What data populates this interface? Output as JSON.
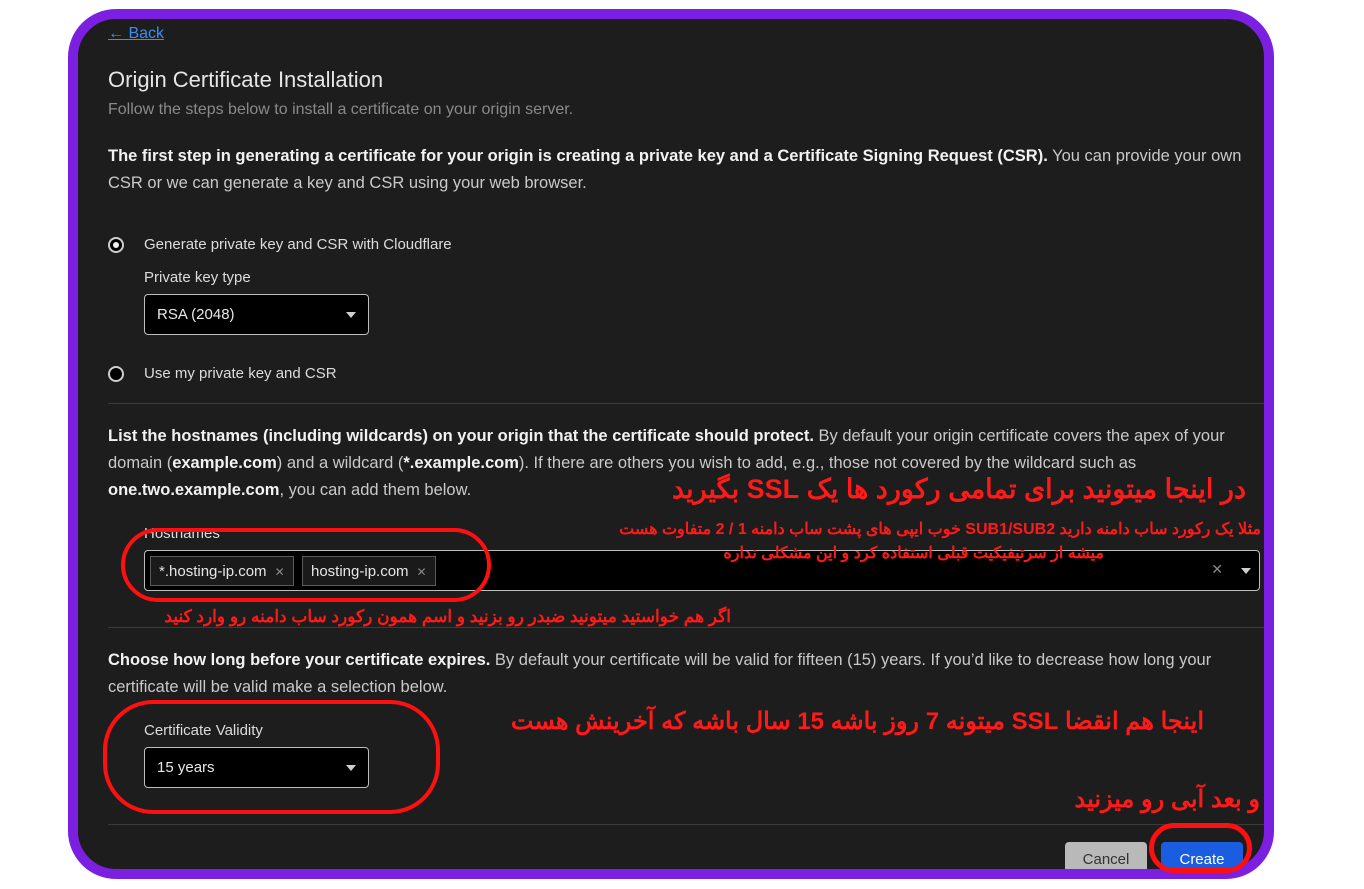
{
  "back_label": "← Back",
  "page_title": "Origin Certificate Installation",
  "page_subtitle": "Follow the steps below to install a certificate on your origin server.",
  "step1": {
    "bold": "The first step in generating a certificate for your origin is creating a private key and a Certificate Signing Request (CSR).",
    "rest": " You can provide your own CSR or we can generate a key and CSR using your web browser."
  },
  "radio_generate_label": "Generate private key and CSR with Cloudflare",
  "private_key_type_label": "Private key type",
  "private_key_type_value": "RSA (2048)",
  "radio_own_label": "Use my private key and CSR",
  "step2": {
    "bold": "List the hostnames (including wildcards) on your origin that the certificate should protect.",
    "t1": " By default your origin certificate covers the apex of your domain (",
    "b1": "example.com",
    "t2": ") and a wildcard (",
    "b2": "*.example.com",
    "t3": "). If there are others you wish to add, e.g., those not covered by the wildcard such as ",
    "b3": "one.two.example.com",
    "t4": ", you can add them below."
  },
  "hostnames_label": "Hostnames",
  "hostnames": [
    "*.hosting-ip.com",
    "hosting-ip.com"
  ],
  "step3": {
    "bold": "Choose how long before your certificate expires.",
    "rest": " By default your certificate will be valid for fifteen (15) years. If you’d like to decrease how long your certificate will be valid make a selection below."
  },
  "validity_label": "Certificate Validity",
  "validity_value": "15 years",
  "cancel_label": "Cancel",
  "create_label": "Create",
  "annotations": {
    "a1": "در اینجا میتونید برای تمامی رکورد ها یک SSL بگیرید",
    "a2": "مثلا یک رکورد ساب دامنه دارید SUB1/SUB2   خوب ایپی های پشت ساب دامنه 1 / 2 متفاوت هست",
    "a3": "میشه از سرتیفیکیت قبلی استفاده کرد و این مشکلی نداره",
    "a4": "اگر هم خواستید میتونید ضبدر رو بزنید و اسم همون  رکورد ساب دامنه رو وارد کنید",
    "a5": "اینجا هم انقضا SSL  میتونه 7 روز باشه 15 سال باشه که آخرینش هست",
    "a6": "و بعد آبی رو میزنید"
  },
  "colors": {
    "frame": "#7b1fe0",
    "annotation": "#ff1a1a",
    "primary": "#1a5de0",
    "link": "#3b8ef5"
  }
}
